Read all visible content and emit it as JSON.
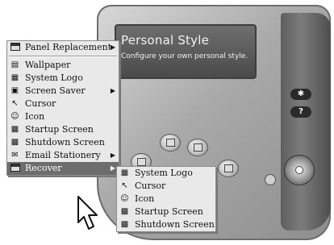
{
  "panel": {
    "title": "Personal Style",
    "subtitle": "Configure your own personal style.",
    "help_label": "?",
    "extra_label": "✱"
  },
  "main_menu": {
    "items": [
      {
        "label": "Panel Replacement",
        "icon": "panel-icon",
        "submenu": true
      },
      {
        "separator": true
      },
      {
        "label": "Wallpaper",
        "icon": "wallpaper-icon",
        "submenu": false
      },
      {
        "label": "System Logo",
        "icon": "system-logo-icon",
        "submenu": false
      },
      {
        "label": "Screen Saver",
        "icon": "screen-saver-icon",
        "submenu": true
      },
      {
        "label": "Cursor",
        "icon": "cursor-icon",
        "submenu": false
      },
      {
        "label": "Icon",
        "icon": "smiley-icon",
        "submenu": false
      },
      {
        "label": "Startup Screen",
        "icon": "startup-screen-icon",
        "submenu": false
      },
      {
        "label": "Shutdown Screen",
        "icon": "shutdown-screen-icon",
        "submenu": false
      },
      {
        "label": "Email Stationery",
        "icon": "email-icon",
        "submenu": true
      },
      {
        "label": "Recover",
        "icon": "recover-icon",
        "submenu": true,
        "highlighted": true
      }
    ]
  },
  "sub_menu": {
    "items": [
      {
        "label": "System Logo",
        "icon": "system-logo-icon"
      },
      {
        "label": "Cursor",
        "icon": "cursor-icon"
      },
      {
        "label": "Icon",
        "icon": "smiley-icon"
      },
      {
        "label": "Startup Screen",
        "icon": "startup-screen-icon"
      },
      {
        "label": "Shutdown Screen",
        "icon": "shutdown-screen-icon"
      }
    ]
  }
}
